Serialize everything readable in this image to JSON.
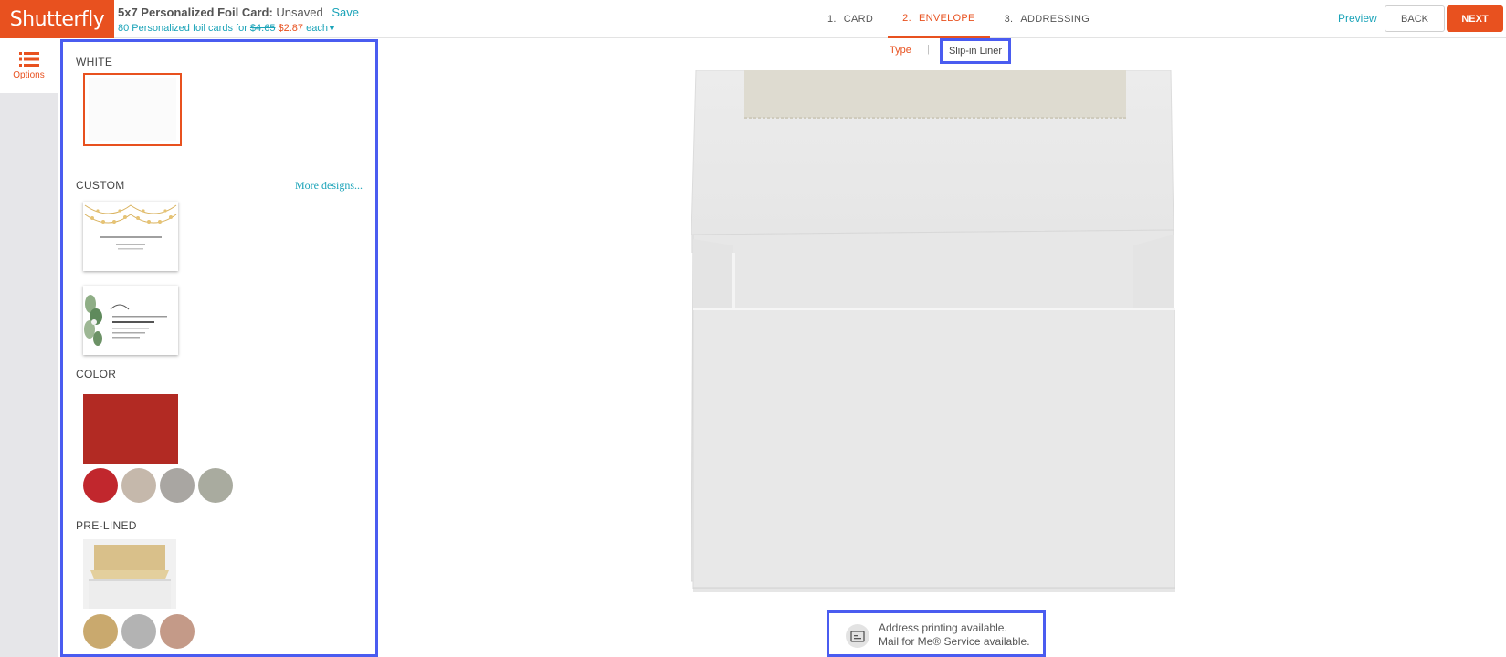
{
  "brand": {
    "logo_text": "Shutterfly",
    "accent": "#e8511f",
    "link": "#1aa3b8",
    "highlight": "#4a5cf0"
  },
  "project": {
    "title": "5x7 Personalized Foil Card:",
    "status": "Unsaved",
    "save_label": "Save",
    "price_prefix": "80 Personalized foil cards for",
    "old_price": "$4.65",
    "new_price": "$2.87",
    "price_suffix": "each",
    "dropdown_icon": "chevron-down-icon"
  },
  "steps": [
    {
      "num": "1.",
      "label": "CARD",
      "active": false
    },
    {
      "num": "2.",
      "label": "ENVELOPE",
      "active": true
    },
    {
      "num": "3.",
      "label": "ADDRESSING",
      "active": false
    }
  ],
  "actions": {
    "preview": "Preview",
    "back": "BACK",
    "next": "NEXT"
  },
  "rail": {
    "options_label": "Options",
    "options_icon": "list-icon"
  },
  "options": {
    "white_title": "WHITE",
    "custom_title": "CUSTOM",
    "more_designs": "More designs...",
    "color_title": "COLOR",
    "color_selected": "#b22a23",
    "color_swatches": [
      "#c1272d",
      "#c5b8ab",
      "#a9a6a2",
      "#a9ab9f"
    ],
    "prelined_title": "PRE-LINED",
    "prelined_swatches": [
      "#c9a96e",
      "#b3b3b3",
      "#c49a88"
    ]
  },
  "subtabs": {
    "type": "Type",
    "slip_in_liner": "Slip-in Liner"
  },
  "info": {
    "line1": "Address printing available.",
    "line2": "Mail for Me® Service available.",
    "icon": "address-card-icon"
  }
}
